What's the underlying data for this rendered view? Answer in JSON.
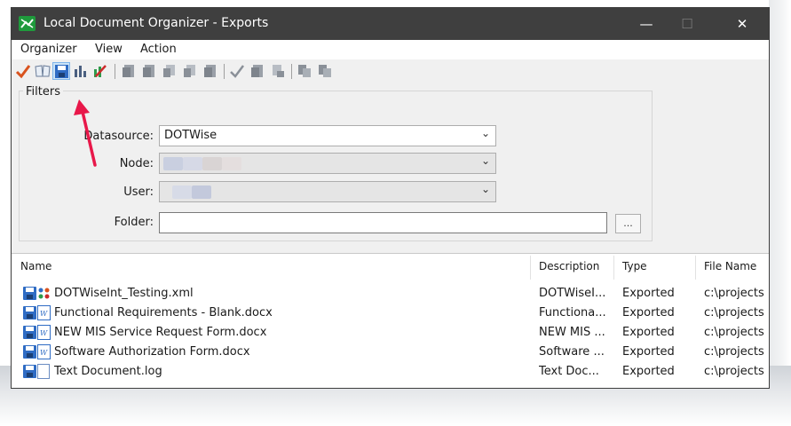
{
  "window": {
    "title": "Local Document Organizer - Exports"
  },
  "title_buttons": {
    "minimize": "—",
    "maximize": "☐",
    "close": "✕"
  },
  "menu": {
    "items": [
      "Organizer",
      "View",
      "Action"
    ]
  },
  "toolbar": {
    "buttons": [
      "check-icon",
      "book-icon",
      "save-icon",
      "column-chart-icon",
      "remove-chart-icon",
      "doc-icon",
      "doc-icon",
      "doc-export-icon",
      "doc-import-icon",
      "doc-icon",
      "check-icon",
      "doc-icon",
      "doc-link-icon",
      "copy-icon",
      "paste-icon"
    ]
  },
  "filters": {
    "legend": "Filters",
    "datasource_label": "Datasource:",
    "datasource_value": "DOTWise",
    "node_label": "Node:",
    "user_label": "User:",
    "folder_label": "Folder:",
    "folder_value": "",
    "browse_label": "..."
  },
  "list": {
    "columns": {
      "name": "Name",
      "description": "Description",
      "type": "Type",
      "file_name": "File Name"
    },
    "rows": [
      {
        "name": "DOTWiseInt_Testing.xml",
        "description": "DOTWiseI...",
        "type": "Exported",
        "file": "c:\\projects"
      },
      {
        "name": "Functional Requirements - Blank.docx",
        "description": "Functiona...",
        "type": "Exported",
        "file": "c:\\projects"
      },
      {
        "name": "NEW MIS Service Request Form.docx",
        "description": "NEW MIS ...",
        "type": "Exported",
        "file": "c:\\projects"
      },
      {
        "name": "Software Authorization Form.docx",
        "description": "Software ...",
        "type": "Exported",
        "file": "c:\\projects"
      },
      {
        "name": "Text Document.log",
        "description": "Text Doc...",
        "type": "Exported",
        "file": "c:\\projects"
      }
    ]
  },
  "colors": {
    "titlebar": "#3f3f3f",
    "accent_arrow": "#e8184a",
    "checkmark": "#d9531e",
    "save_icon": "#2f6cc4"
  }
}
